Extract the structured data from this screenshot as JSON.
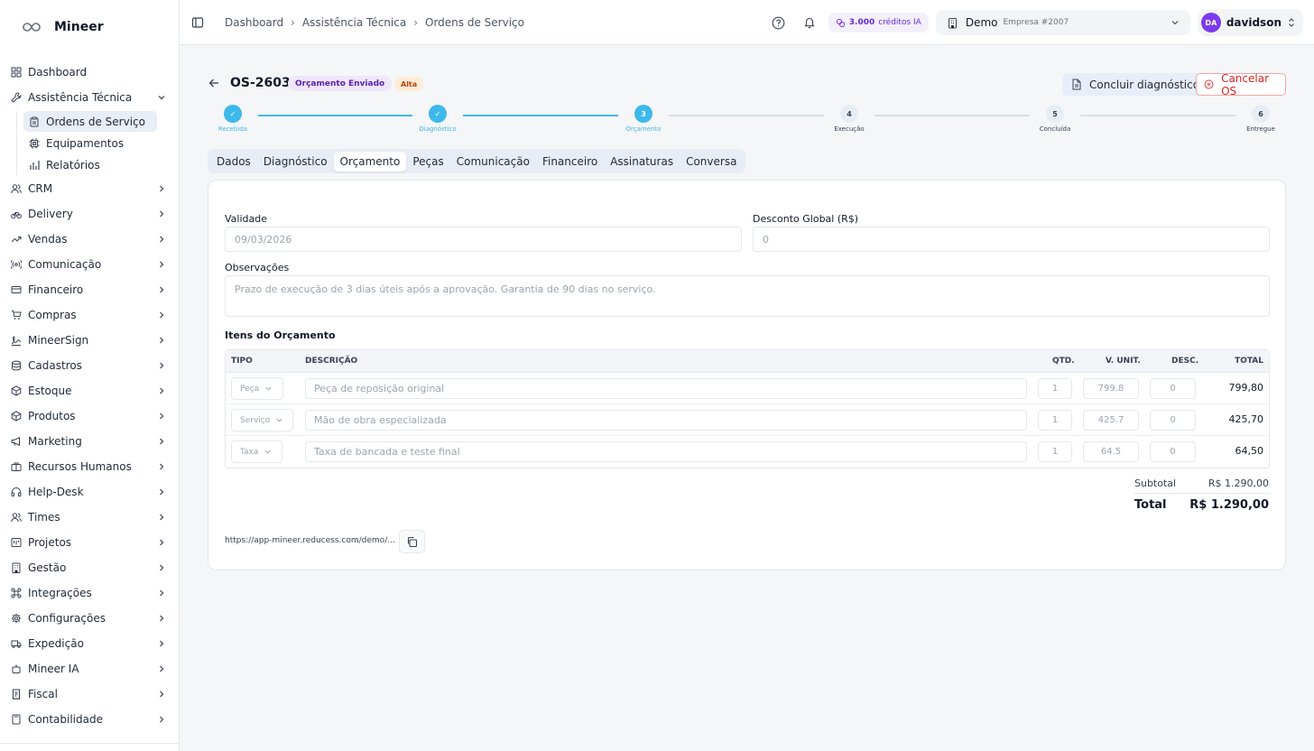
{
  "brand": {
    "name": "Mineer"
  },
  "sidebar": {
    "items": [
      {
        "label": "Dashboard",
        "icon": "dashboard-icon"
      },
      {
        "label": "Assistência Técnica",
        "icon": "wrench-icon",
        "expanded": true,
        "children": [
          {
            "label": "Ordens de Serviço",
            "icon": "clipboard-icon",
            "active": true
          },
          {
            "label": "Equipamentos",
            "icon": "cpu-icon"
          },
          {
            "label": "Relatórios",
            "icon": "bar-chart-icon"
          }
        ]
      },
      {
        "label": "CRM",
        "icon": "users-icon"
      },
      {
        "label": "Delivery",
        "icon": "bike-icon"
      },
      {
        "label": "Vendas",
        "icon": "trending-up-icon"
      },
      {
        "label": "Comunicação",
        "icon": "radio-icon"
      },
      {
        "label": "Financeiro",
        "icon": "credit-card-icon"
      },
      {
        "label": "Compras",
        "icon": "cart-icon"
      },
      {
        "label": "MineerSign",
        "icon": "signature-icon"
      },
      {
        "label": "Cadastros",
        "icon": "database-icon"
      },
      {
        "label": "Estoque",
        "icon": "package-icon"
      },
      {
        "label": "Produtos",
        "icon": "box-icon"
      },
      {
        "label": "Marketing",
        "icon": "megaphone-icon"
      },
      {
        "label": "Recursos Humanos",
        "icon": "briefcase-icon"
      },
      {
        "label": "Help-Desk",
        "icon": "headphones-icon"
      },
      {
        "label": "Times",
        "icon": "team-icon"
      },
      {
        "label": "Projetos",
        "icon": "kanban-icon"
      },
      {
        "label": "Gestão",
        "icon": "building-icon"
      },
      {
        "label": "Integrações",
        "icon": "command-icon"
      },
      {
        "label": "Configurações",
        "icon": "gear-icon"
      },
      {
        "label": "Expedição",
        "icon": "truck-icon"
      },
      {
        "label": "Mineer IA",
        "icon": "bot-icon"
      },
      {
        "label": "Fiscal",
        "icon": "receipt-icon"
      },
      {
        "label": "Contabilidade",
        "icon": "calculator-icon"
      }
    ]
  },
  "topbar": {
    "breadcrumb": [
      "Dashboard",
      "Assistência Técnica",
      "Ordens de Serviço"
    ],
    "credits": {
      "amount": "3.000",
      "label": "créditos IA"
    },
    "company": {
      "name": "Demo",
      "sub": "Empresa #2007"
    },
    "user": {
      "initials": "DA",
      "name": "davidson"
    }
  },
  "os": {
    "id": "OS-2603",
    "status": "Orçamento Enviado",
    "priority": "Alta",
    "actions": {
      "diagnose": "Concluir diagnóstico",
      "cancel": "Cancelar OS"
    }
  },
  "stepper": {
    "steps": [
      {
        "num": "✓",
        "label": "Recebida",
        "state": "done"
      },
      {
        "num": "✓",
        "label": "Diagnóstico",
        "state": "done"
      },
      {
        "num": "3",
        "label": "Orçamento",
        "state": "current"
      },
      {
        "num": "4",
        "label": "Execução",
        "state": "todo"
      },
      {
        "num": "5",
        "label": "Concluída",
        "state": "todo"
      },
      {
        "num": "6",
        "label": "Entregue",
        "state": "todo"
      }
    ]
  },
  "tabs": [
    "Dados",
    "Diagnóstico",
    "Orçamento",
    "Peças",
    "Comunicação",
    "Financeiro",
    "Assinaturas",
    "Conversa"
  ],
  "active_tab": "Orçamento",
  "form": {
    "validade": {
      "label": "Validade",
      "value": "09/03/2026"
    },
    "desconto": {
      "label": "Desconto Global (R$)",
      "value": "0"
    },
    "observacoes": {
      "label": "Observações",
      "value": "Prazo de execução de 3 dias úteis após a aprovação. Garantia de 90 dias no serviço."
    }
  },
  "items": {
    "title": "Itens do Orçamento",
    "columns": {
      "tipo": "TIPO",
      "descricao": "DESCRIÇÃO",
      "qtd": "QTD.",
      "vunit": "V. UNIT.",
      "desc": "DESC.",
      "total": "TOTAL"
    },
    "rows": [
      {
        "tipo": "Peça",
        "descricao": "Peça de reposição original",
        "qtd": "1",
        "vunit": "799.8",
        "desc": "0",
        "total": "799,80"
      },
      {
        "tipo": "Serviço",
        "descricao": "Mão de obra especializada",
        "qtd": "1",
        "vunit": "425.7",
        "desc": "0",
        "total": "425,70"
      },
      {
        "tipo": "Taxa",
        "descricao": "Taxa de bancada e teste final",
        "qtd": "1",
        "vunit": "64.5",
        "desc": "0",
        "total": "64,50"
      }
    ],
    "subtotal_label": "Subtotal",
    "subtotal": "R$ 1.290,00",
    "total_label": "Total",
    "total": "R$ 1.290,00"
  },
  "share_link": "https://app-mineer.reducess.com/demo/...",
  "colors": {
    "accent": "#3eb8ea",
    "primary_purple": "#7c3aed",
    "danger": "#dc2626"
  }
}
